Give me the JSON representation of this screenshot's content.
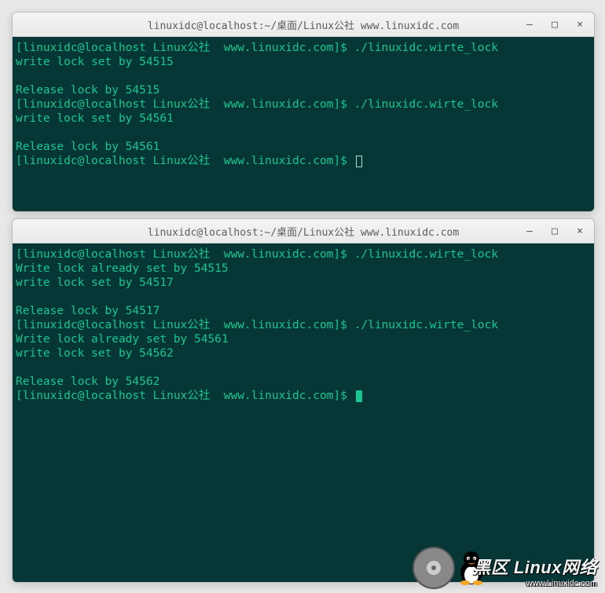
{
  "windows": {
    "top": {
      "title": "linuxidc@localhost:~/桌面/Linux公社   www.linuxidc.com",
      "prompt_open": "[",
      "prompt_user": "linuxidc",
      "prompt_at": "@",
      "prompt_host": "localhost",
      "prompt_space": " ",
      "prompt_path": "Linux公社  www.linuxidc.com",
      "prompt_close": "]$ ",
      "entries": [
        {
          "cmd": "./linuxidc.wirte_lock",
          "out": [
            "write lock set by 54515",
            "",
            "Release lock by 54515"
          ]
        },
        {
          "cmd": "./linuxidc.wirte_lock",
          "out": [
            "write lock set by 54561",
            "",
            "Release lock by 54561"
          ]
        }
      ],
      "cursor": "outline"
    },
    "bottom": {
      "title": "linuxidc@localhost:~/桌面/Linux公社   www.linuxidc.com",
      "prompt_open": "[",
      "prompt_user": "linuxidc",
      "prompt_at": "@",
      "prompt_host": "localhost",
      "prompt_space": " ",
      "prompt_path": "Linux公社  www.linuxidc.com",
      "prompt_close": "]$ ",
      "entries": [
        {
          "cmd": "./linuxidc.wirte_lock",
          "out": [
            "Write lock already set by 54515",
            "write lock set by 54517",
            "",
            "Release lock by 54517"
          ]
        },
        {
          "cmd": "./linuxidc.wirte_lock",
          "out": [
            "Write lock already set by 54561",
            "write lock set by 54562",
            "",
            "Release lock by 54562"
          ]
        }
      ],
      "cursor": "block"
    }
  },
  "controls": {
    "minimize": "–",
    "maximize": "□",
    "close": "×"
  },
  "watermark": {
    "line1_pre": "黑区 ",
    "line1_brand": "Linux",
    "line1_post": "网络",
    "line2": "www.Linuxidc.com"
  }
}
